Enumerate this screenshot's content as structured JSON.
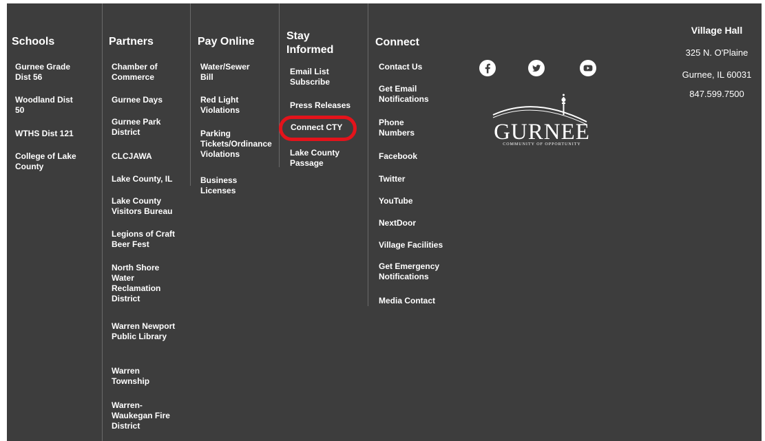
{
  "schools": {
    "title": "Schools",
    "links": [
      "Gurnee Grade Dist 56",
      "Woodland Dist 50",
      "WTHS Dist 121",
      "College of Lake County"
    ]
  },
  "partners": {
    "title": "Partners",
    "links": [
      "Chamber of Commerce",
      "Gurnee Days",
      "Gurnee Park District",
      "CLCJAWA",
      "Lake County, IL",
      "Lake County Visitors Bureau",
      "Legions of Craft Beer Fest",
      "North Shore Water Reclamation District",
      "Warren Newport Public Library",
      "Warren Township",
      "Warren-Waukegan Fire District"
    ]
  },
  "pay_online": {
    "title": "Pay Online",
    "links": [
      "Water/Sewer Bill",
      "Red Light Violations",
      "Parking Tickets/Ordinance Violations",
      "Business Licenses"
    ]
  },
  "stay_informed": {
    "title": "Stay Informed",
    "links": [
      "Email List Subscribe",
      "Press Releases",
      "Connect CTY",
      "Lake County Passage"
    ]
  },
  "connect": {
    "title": "Connect",
    "links": [
      "Contact Us",
      "Get Email Notifications",
      "Phone Numbers",
      "Facebook",
      "Twitter",
      "YouTube",
      "NextDoor",
      "Village Facilities",
      "Get Emergency Notifications",
      "Media Contact"
    ]
  },
  "social_icons": [
    "facebook-icon",
    "twitter-icon",
    "youtube-icon"
  ],
  "logo": {
    "name": "GURNEE",
    "tagline": "COMMUNITY OF OPPORTUNITY"
  },
  "village_hall": {
    "title": "Village Hall",
    "address1": "325 N. O'Plaine",
    "address2": "Gurnee, IL 60031",
    "phone": "847.599.7500"
  },
  "colors": {
    "background": "#3d3d3d",
    "text": "#ffffff",
    "highlight": "#e4131b",
    "divider": "#6a6a6a"
  }
}
